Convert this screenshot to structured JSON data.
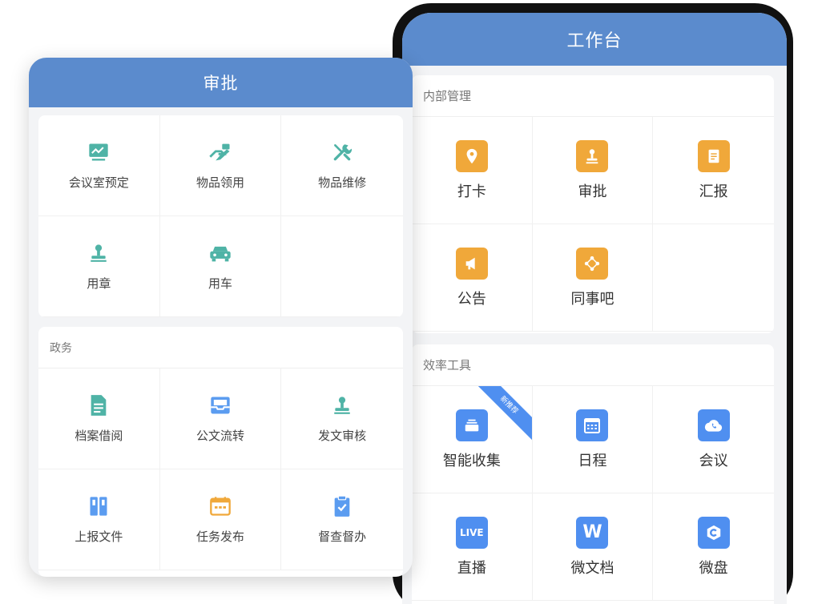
{
  "phone": {
    "title": "工作台",
    "internal": {
      "title": "内部管理",
      "items": [
        {
          "label": "打卡",
          "icon": "location-pin-icon"
        },
        {
          "label": "审批",
          "icon": "stamp-icon"
        },
        {
          "label": "汇报",
          "icon": "report-document-icon"
        },
        {
          "label": "公告",
          "icon": "megaphone-icon"
        },
        {
          "label": "同事吧",
          "icon": "network-icon"
        }
      ]
    },
    "efficiency": {
      "title": "效率工具",
      "items": [
        {
          "label": "智能收集",
          "icon": "collection-tray-icon",
          "badge": "新推荐"
        },
        {
          "label": "日程",
          "icon": "calendar-icon"
        },
        {
          "label": "会议",
          "icon": "cloud-phone-icon"
        },
        {
          "label": "直播",
          "icon": "live-icon",
          "icon_text": "LIVE"
        },
        {
          "label": "微文档",
          "icon": "word-document-icon",
          "icon_text": "W"
        },
        {
          "label": "微盘",
          "icon": "cloud-drive-icon"
        }
      ]
    }
  },
  "approval": {
    "title": "审批",
    "general": {
      "items": [
        {
          "label": "会议室预定",
          "icon": "presentation-board-icon"
        },
        {
          "label": "物品领用",
          "icon": "hand-receive-icon"
        },
        {
          "label": "物品维修",
          "icon": "tools-icon"
        },
        {
          "label": "用章",
          "icon": "stamp-icon"
        },
        {
          "label": "用车",
          "icon": "car-icon"
        }
      ]
    },
    "government": {
      "title": "政务",
      "items": [
        {
          "label": "档案借阅",
          "icon": "file-document-icon"
        },
        {
          "label": "公文流转",
          "icon": "inbox-tray-icon"
        },
        {
          "label": "发文审核",
          "icon": "stamp-icon"
        },
        {
          "label": "上报文件",
          "icon": "binders-icon"
        },
        {
          "label": "任务发布",
          "icon": "calendar-task-icon"
        },
        {
          "label": "督查督办",
          "icon": "clipboard-check-icon"
        }
      ]
    }
  },
  "colors": {
    "header_blue": "#5b8bcd",
    "icon_orange": "#f0a83a",
    "icon_blue": "#4f8ff0",
    "icon_teal": "#4fb3a6",
    "icon_light_blue": "#5b9cf0",
    "icon_amber": "#f0a83a"
  }
}
